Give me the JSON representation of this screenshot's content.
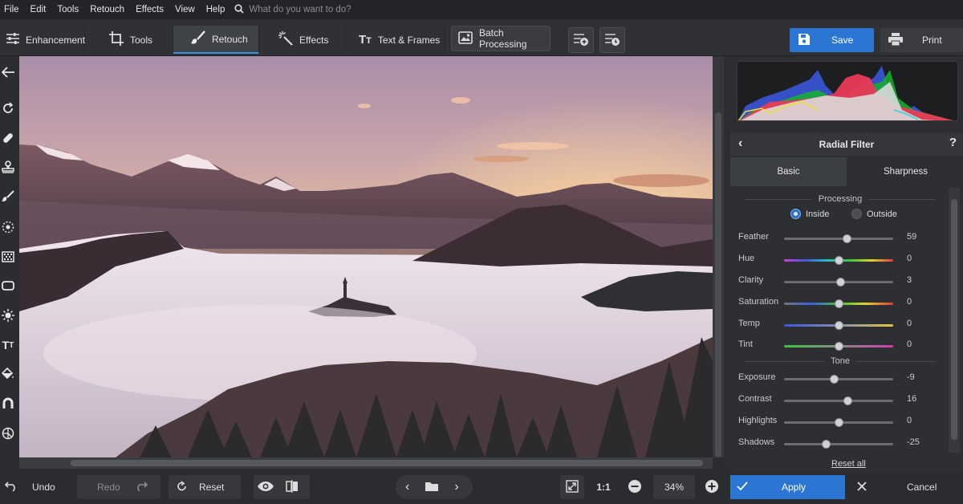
{
  "menu": {
    "items": [
      "File",
      "Edit",
      "Tools",
      "Retouch",
      "Effects",
      "View",
      "Help"
    ],
    "search_placeholder": "What do you want to do?"
  },
  "toolbar": {
    "tabs": [
      {
        "label": "Enhancement",
        "icon": "sliders-icon"
      },
      {
        "label": "Tools",
        "icon": "crop-icon"
      },
      {
        "label": "Retouch",
        "icon": "brush-icon"
      },
      {
        "label": "Effects",
        "icon": "magic-wand-icon"
      },
      {
        "label": "Text & Frames",
        "icon": "text-icon"
      }
    ],
    "active_tab": "Retouch",
    "batch_label": "Batch Processing",
    "save_label": "Save",
    "print_label": "Print"
  },
  "panel": {
    "title": "Radial Filter",
    "tabs": [
      "Basic",
      "Sharpness"
    ],
    "active_tab": "Basic",
    "processing_label": "Processing",
    "radio": {
      "inside": "Inside",
      "outside": "Outside",
      "selected": "Inside"
    },
    "tone_label": "Tone",
    "sliders_processing": [
      {
        "label": "Feather",
        "value": "59"
      },
      {
        "label": "Hue",
        "value": "0"
      },
      {
        "label": "Clarity",
        "value": "3"
      },
      {
        "label": "Saturation",
        "value": "0"
      },
      {
        "label": "Temp",
        "value": "0"
      },
      {
        "label": "Tint",
        "value": "0"
      }
    ],
    "sliders_tone": [
      {
        "label": "Exposure",
        "value": "-9"
      },
      {
        "label": "Contrast",
        "value": "16"
      },
      {
        "label": "Highlights",
        "value": "0"
      },
      {
        "label": "Shadows",
        "value": "-25"
      }
    ],
    "reset_all": "Reset all"
  },
  "bottom": {
    "undo": "Undo",
    "redo": "Redo",
    "reset": "Reset",
    "ratio": "1:1",
    "zoom": "34%",
    "apply": "Apply",
    "cancel": "Cancel"
  },
  "colors": {
    "accent": "#2a76d2",
    "panel": "#2d2f32",
    "toolbar": "#2f3134"
  }
}
